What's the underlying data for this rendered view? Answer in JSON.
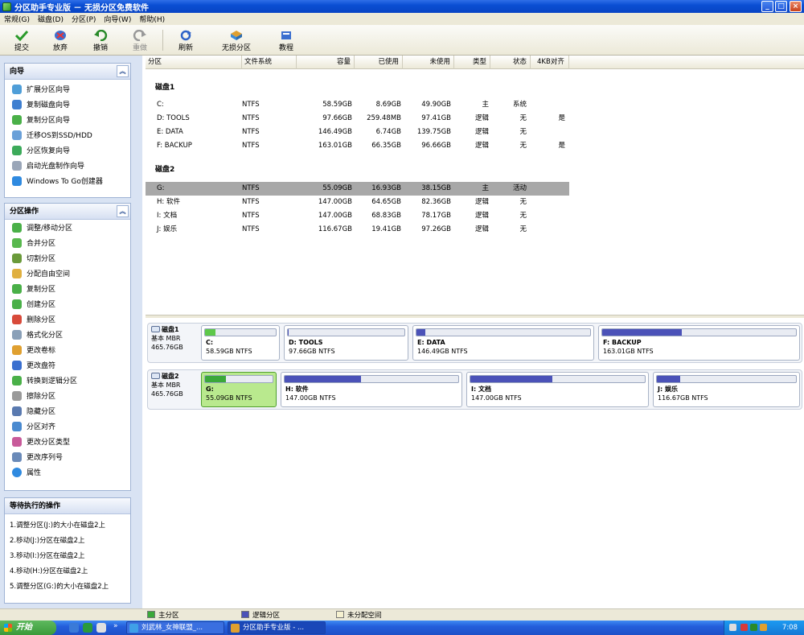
{
  "window": {
    "title": "分区助手专业版 － 无损分区免费软件",
    "min": "_",
    "max": "□",
    "close": "×"
  },
  "menu": [
    "常规(G)",
    "磁盘(D)",
    "分区(P)",
    "向导(W)",
    "帮助(H)"
  ],
  "toolbar": {
    "submit": "提交",
    "discard": "放弃",
    "undo": "撤销",
    "redo": "重做",
    "refresh": "刷新",
    "lossless": "无损分区",
    "tutorial": "教程"
  },
  "wizard": {
    "title": "向导",
    "items": [
      "扩展分区向导",
      "复制磁盘向导",
      "复制分区向导",
      "迁移OS到SSD/HDD",
      "分区恢复向导",
      "启动光盘制作向导",
      "Windows To Go创建器"
    ]
  },
  "ops": {
    "title": "分区操作",
    "items": [
      "调整/移动分区",
      "合并分区",
      "切割分区",
      "分配自由空间",
      "复制分区",
      "创建分区",
      "删除分区",
      "格式化分区",
      "更改卷标",
      "更改盘符",
      "转换到逻辑分区",
      "擦除分区",
      "隐藏分区",
      "分区对齐",
      "更改分区类型",
      "更改序列号",
      "属性"
    ]
  },
  "pending": {
    "title": "等待执行的操作",
    "items": [
      "1.调整分区(J:)的大小在磁盘2上",
      "2.移动(J:)分区在磁盘2上",
      "3.移动(I:)分区在磁盘2上",
      "4.移动(H:)分区在磁盘2上",
      "5.调整分区(G:)的大小在磁盘2上"
    ]
  },
  "columns": [
    "分区",
    "文件系统",
    "容量",
    "已使用",
    "未使用",
    "类型",
    "状态",
    "4KB对齐"
  ],
  "disks": [
    {
      "name": "磁盘1",
      "partitions": [
        {
          "name": "C:",
          "fs": "NTFS",
          "cap": "58.59GB",
          "used": "8.69GB",
          "free": "49.90GB",
          "type": "主",
          "status": "系统",
          "align": ""
        },
        {
          "name": "D: TOOLS",
          "fs": "NTFS",
          "cap": "97.66GB",
          "used": "259.48MB",
          "free": "97.41GB",
          "type": "逻辑",
          "status": "无",
          "align": "是"
        },
        {
          "name": "E: DATA",
          "fs": "NTFS",
          "cap": "146.49GB",
          "used": "6.74GB",
          "free": "139.75GB",
          "type": "逻辑",
          "status": "无",
          "align": ""
        },
        {
          "name": "F: BACKUP",
          "fs": "NTFS",
          "cap": "163.01GB",
          "used": "66.35GB",
          "free": "96.66GB",
          "type": "逻辑",
          "status": "无",
          "align": "是"
        }
      ]
    },
    {
      "name": "磁盘2",
      "partitions": [
        {
          "name": "G:",
          "fs": "NTFS",
          "cap": "55.09GB",
          "used": "16.93GB",
          "free": "38.15GB",
          "type": "主",
          "status": "活动",
          "align": ""
        },
        {
          "name": "H: 软件",
          "fs": "NTFS",
          "cap": "147.00GB",
          "used": "64.65GB",
          "free": "82.36GB",
          "type": "逻辑",
          "status": "无",
          "align": ""
        },
        {
          "name": "I: 文档",
          "fs": "NTFS",
          "cap": "147.00GB",
          "used": "68.83GB",
          "free": "78.17GB",
          "type": "逻辑",
          "status": "无",
          "align": ""
        },
        {
          "name": "J: 娱乐",
          "fs": "NTFS",
          "cap": "116.67GB",
          "used": "19.41GB",
          "free": "97.26GB",
          "type": "逻辑",
          "status": "无",
          "align": ""
        }
      ]
    }
  ],
  "diskmap": [
    {
      "name": "磁盘1",
      "kind": "基本 MBR",
      "size": "465.76GB",
      "parts": [
        {
          "title": "C:",
          "sub": "58.59GB NTFS",
          "used_frac": 0.15,
          "color": "#5ec84a"
        },
        {
          "title": "D: TOOLS",
          "sub": "97.66GB NTFS",
          "used_frac": 0.01,
          "color": "#4b52b8"
        },
        {
          "title": "E: DATA",
          "sub": "146.49GB NTFS",
          "used_frac": 0.05,
          "color": "#4b52b8"
        },
        {
          "title": "F: BACKUP",
          "sub": "163.01GB NTFS",
          "used_frac": 0.41,
          "color": "#4b52b8"
        }
      ]
    },
    {
      "name": "磁盘2",
      "kind": "基本 MBR",
      "size": "465.76GB",
      "parts": [
        {
          "title": "G:",
          "sub": "55.09GB NTFS",
          "used_frac": 0.31,
          "color": "#3aa83a"
        },
        {
          "title": "H: 软件",
          "sub": "147.00GB NTFS",
          "used_frac": 0.44,
          "color": "#4b52b8"
        },
        {
          "title": "I: 文档",
          "sub": "147.00GB NTFS",
          "used_frac": 0.47,
          "color": "#4b52b8"
        },
        {
          "title": "J: 娱乐",
          "sub": "116.67GB NTFS",
          "used_frac": 0.17,
          "color": "#4b52b8"
        }
      ]
    }
  ],
  "legend": {
    "primary": "主分区",
    "logical": "逻辑分区",
    "unalloc": "未分配空间"
  },
  "taskbar": {
    "start": "开始",
    "task1": "刘武林_女神联盟_...",
    "task2": "分区助手专业版 - ...",
    "clock": "7:08",
    "more": "»"
  }
}
